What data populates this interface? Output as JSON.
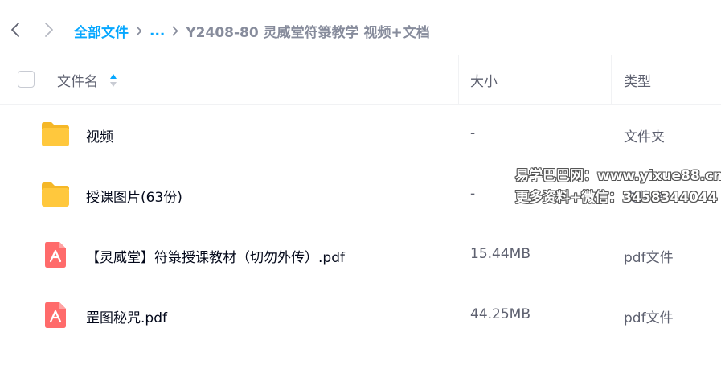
{
  "breadcrumb": {
    "root": "全部文件",
    "ellipsis": "...",
    "current": "Y2408-80 灵威堂符箓教学 视频+文档"
  },
  "table": {
    "headers": {
      "name": "文件名",
      "size": "大小",
      "type": "类型"
    },
    "rows": [
      {
        "icon": "folder-icon",
        "name": "视频",
        "size": "-",
        "type": "文件夹"
      },
      {
        "icon": "folder-icon",
        "name": "授课图片(63份)",
        "size": "-",
        "type": "文件夹"
      },
      {
        "icon": "pdf-icon",
        "name": "【灵威堂】符箓授课教材（切勿外传）.pdf",
        "size": "15.44MB",
        "type": "pdf文件"
      },
      {
        "icon": "pdf-icon",
        "name": "罡图秘咒.pdf",
        "size": "44.25MB",
        "type": "pdf文件"
      }
    ]
  },
  "watermark": {
    "line1": "易学巴巴网：www.yixue88.cn",
    "line2": "更多资料+微信：3458344044"
  },
  "colors": {
    "accent": "#06a7ff",
    "folder": "#ffc83d",
    "pdf": "#ff6b6b"
  }
}
